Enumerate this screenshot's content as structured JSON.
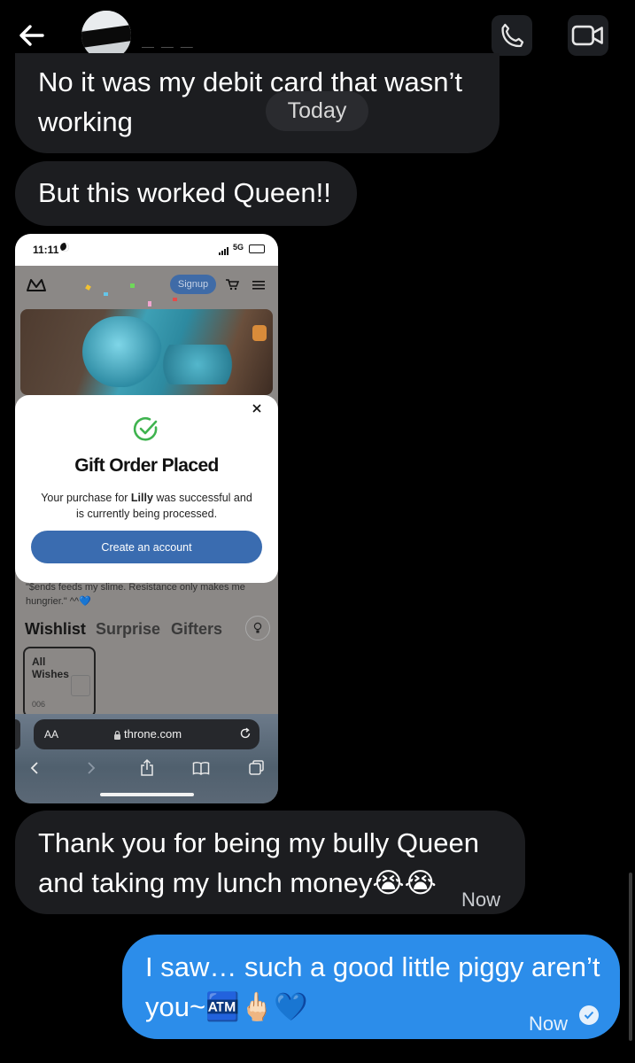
{
  "header": {
    "contact_name": "— — —"
  },
  "messages": [
    {
      "id": "m1",
      "text_line1": "No it was my debit card that wasn’t",
      "text_line2": "working"
    },
    {
      "id": "m2",
      "text": "But this worked Queen!!"
    },
    {
      "id": "m3",
      "text_line1": "Thank you for being my bully Queen",
      "text_line2": "and taking my lunch money😭😭",
      "time": "Now"
    },
    {
      "id": "m4",
      "text_line1": "I saw… such a good little piggy aren’t",
      "text_line2": "you~🏧🖕🏻💙",
      "time": "Now"
    }
  ],
  "date_chip": "Today",
  "screenshot": {
    "status_time": "11:11",
    "signal": "5G",
    "signup_label": "Signup",
    "modal_title": "Gift Order Placed",
    "modal_text_pre": "Your purchase for ",
    "modal_text_name": "Lilly",
    "modal_text_post": " was successful and",
    "modal_text_line2": "is currently being processed.",
    "modal_button": "Create an account",
    "bio_line1": "\"$ends feeds my slime. Resistance only makes me",
    "bio_line2": "hungrier.\" ^^💙",
    "tabs": [
      "Wishlist",
      "Surprise",
      "Gifters"
    ],
    "card_title_1": "All",
    "card_title_2": "Wishes",
    "card_count": "006",
    "url_aa": "AA",
    "url": "throne.com"
  },
  "colors": {
    "incoming_bubble": "#1c1d20",
    "outgoing_bubble": "#2c8dea",
    "modal_button": "#3a6cb0",
    "success_green": "#3fb34f"
  },
  "icons": [
    "back-arrow-icon",
    "phone-icon",
    "video-icon",
    "check-circle-icon",
    "close-icon",
    "lock-icon",
    "reload-icon",
    "cart-icon",
    "menu-icon",
    "bulb-icon",
    "read-check-icon"
  ]
}
